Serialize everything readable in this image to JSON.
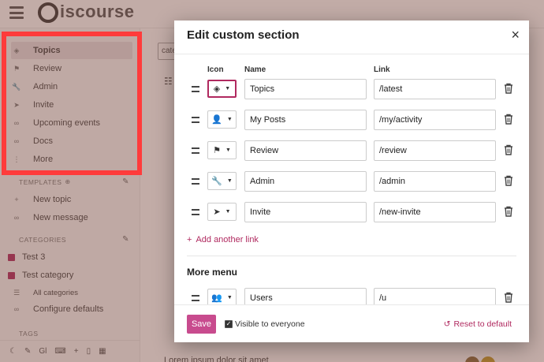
{
  "app": {
    "logo_text": "iscourse"
  },
  "sidebar": {
    "items": [
      {
        "label": "Topics",
        "icon": "layers-icon"
      },
      {
        "label": "Review",
        "icon": "flag-icon"
      },
      {
        "label": "Admin",
        "icon": "wrench-icon"
      },
      {
        "label": "Invite",
        "icon": "paper-plane-icon"
      },
      {
        "label": "Upcoming events",
        "icon": "link-icon"
      },
      {
        "label": "Docs",
        "icon": "link-icon"
      },
      {
        "label": "More",
        "icon": "dots-icon"
      }
    ],
    "templates_header": "TEMPLATES",
    "templates": [
      {
        "label": "New topic",
        "icon": "plus-icon"
      },
      {
        "label": "New message",
        "icon": "link-icon"
      }
    ],
    "categories_header": "CATEGORIES",
    "categories": [
      {
        "label": "Test 3"
      },
      {
        "label": "Test category"
      }
    ],
    "all_categories": "All categories",
    "configure_defaults": "Configure defaults",
    "tags_header": "TAGS",
    "footer_text": "Gl"
  },
  "background": {
    "filter_text": "cate",
    "topic_preview_text": "Lorem ipsum dolor sit amet"
  },
  "modal": {
    "title": "Edit custom section",
    "close_symbol": "×",
    "columns": {
      "icon": "Icon",
      "name": "Name",
      "link": "Link"
    },
    "links": [
      {
        "name": "Topics",
        "link": "/latest",
        "icon": "layers-icon"
      },
      {
        "name": "My Posts",
        "link": "/my/activity",
        "icon": "user-icon"
      },
      {
        "name": "Review",
        "link": "/review",
        "icon": "flag-icon"
      },
      {
        "name": "Admin",
        "link": "/admin",
        "icon": "wrench-icon"
      },
      {
        "name": "Invite",
        "link": "/new-invite",
        "icon": "paper-plane-icon"
      }
    ],
    "add_link_label": "Add another link",
    "more_menu_title": "More menu",
    "more_links": [
      {
        "name": "Users",
        "link": "/u",
        "icon": "users-icon"
      }
    ],
    "save_label": "Save",
    "visible_label": "Visible to everyone",
    "reset_label": "Reset to default"
  },
  "colors": {
    "accent": "#b0295f",
    "save_button": "#c84b8e",
    "highlight_border": "#ff3b3b"
  }
}
